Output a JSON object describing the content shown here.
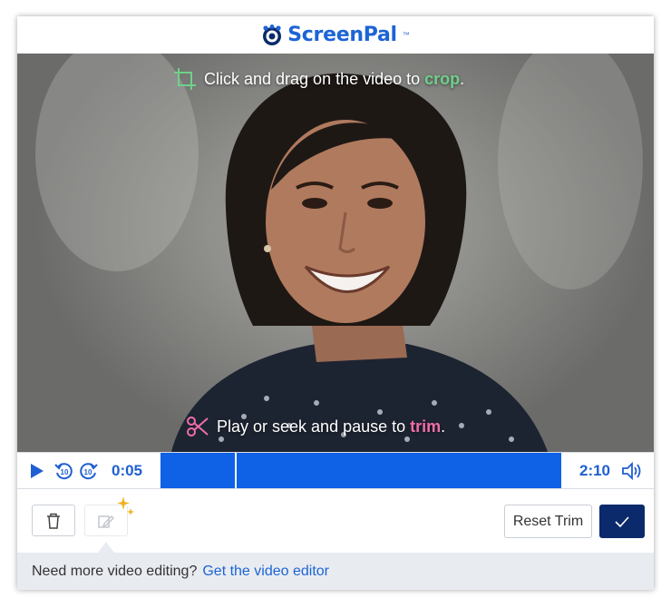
{
  "header": {
    "brand": "ScreenPal",
    "trademark": "™"
  },
  "video": {
    "crop_hint": {
      "prefix": "Click and drag on the video to ",
      "highlight": "crop",
      "suffix": ".",
      "icon": "crop-icon"
    },
    "trim_hint": {
      "prefix": "Play or seek and pause to ",
      "highlight": "trim",
      "suffix": ".",
      "icon": "scissors-icon"
    }
  },
  "controls": {
    "current_time": "0:05",
    "total_time": "2:10",
    "rewind_label": "10",
    "forward_label": "10",
    "playhead_fraction": 0.04,
    "icons": [
      "play-icon",
      "rewind-10-icon",
      "forward-10-icon",
      "volume-icon"
    ]
  },
  "toolbar": {
    "reset_label": "Reset Trim",
    "icons": [
      "trash-icon",
      "effects-icon",
      "sparkle-icon",
      "checkmark-icon"
    ]
  },
  "footer": {
    "text": "Need more video editing?",
    "link": "Get the video editor"
  },
  "colors": {
    "brand_blue": "#1d64d6",
    "timeline_blue": "#0f61e6",
    "confirm_navy": "#0b2a6b",
    "crop_green": "#6fd08a",
    "trim_pink": "#f06ea8"
  }
}
